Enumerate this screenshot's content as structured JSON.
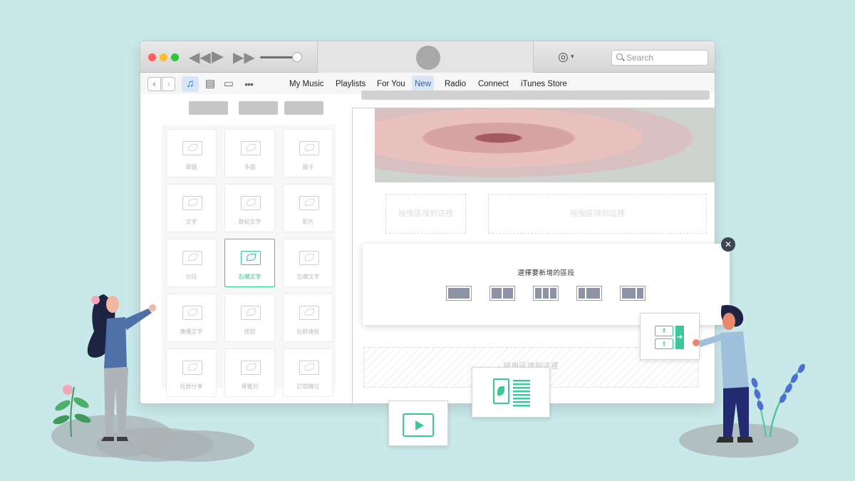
{
  "search": {
    "placeholder": "Search"
  },
  "nav": {
    "back_icon": "chevron-left",
    "forward_icon": "chevron-right",
    "media": [
      "music-note-icon",
      "film-icon",
      "tv-icon",
      "more-icon"
    ],
    "tabs": [
      {
        "label": "My Music",
        "active": false
      },
      {
        "label": "Playlists",
        "active": false
      },
      {
        "label": "For You",
        "active": false
      },
      {
        "label": "New",
        "active": true
      },
      {
        "label": "Radio",
        "active": false
      },
      {
        "label": "Connect",
        "active": false
      },
      {
        "label": "iTunes Store",
        "active": false
      }
    ]
  },
  "widgets": [
    {
      "label": "單圖"
    },
    {
      "label": "多圖"
    },
    {
      "label": "圖卡"
    },
    {
      "label": "文字"
    },
    {
      "label": "群組文字"
    },
    {
      "label": "影片"
    },
    {
      "label": "分段"
    },
    {
      "label": "右欄文字"
    },
    {
      "label": "左欄文字"
    },
    {
      "label": "廣播文字"
    },
    {
      "label": "按鈕"
    },
    {
      "label": "社群連結"
    },
    {
      "label": "社群分享"
    },
    {
      "label": "導覽列"
    },
    {
      "label": "訂閱欄位"
    }
  ],
  "selected_widget": "右欄文字",
  "drop_zones": {
    "small": "拖曳區塊到這裡",
    "wide": "拖曳區塊到這裡",
    "bottom": "拖曳區塊到這裡"
  },
  "modal": {
    "title": "選擇要新增的區段",
    "layouts": [
      "1-column",
      "2-column",
      "3-column",
      "2-column-left",
      "2-column-right"
    ],
    "close_label": "✕"
  },
  "floating_cards": {
    "social": {
      "facebook": "f",
      "twitter": "t"
    }
  },
  "colors": {
    "accent": "#3cc99a",
    "background": "#c8e8ea",
    "active_tab": "#2a62c4"
  }
}
